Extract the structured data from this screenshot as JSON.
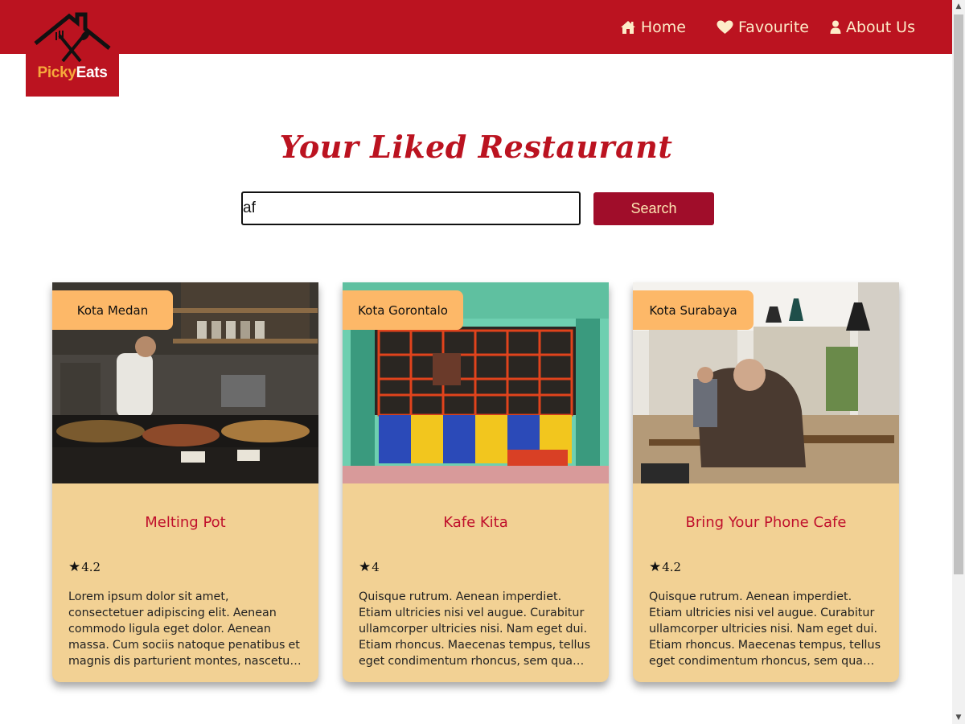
{
  "header": {
    "logo": {
      "part1": "Picky",
      "part2": "Eats"
    },
    "nav": [
      {
        "label": "Home",
        "icon": "home-icon"
      },
      {
        "label": "Favourite",
        "icon": "heart-icon"
      },
      {
        "label": "About Us",
        "icon": "user-icon"
      }
    ]
  },
  "main": {
    "title": "Your Liked Restaurant",
    "search": {
      "value": "af",
      "button_label": "Search"
    }
  },
  "restaurants": [
    {
      "city": "Kota Medan",
      "name": "Melting Pot",
      "rating": "4.2",
      "description": "Lorem ipsum dolor sit amet, consectetuer adipiscing elit. Aenean commodo ligula eget dolor. Aenean massa. Cum sociis natoque penatibus et magnis dis parturient montes, nascetur ridiculus mus."
    },
    {
      "city": "Kota Gorontalo",
      "name": "Kafe Kita",
      "rating": "4",
      "description": "Quisque rutrum. Aenean imperdiet. Etiam ultricies nisi vel augue. Curabitur ullamcorper ultricies nisi. Nam eget dui. Etiam rhoncus. Maecenas tempus, tellus eget condimentum rhoncus, sem quam semper libero."
    },
    {
      "city": "Kota Surabaya",
      "name": "Bring Your Phone Cafe",
      "rating": "4.2",
      "description": "Quisque rutrum. Aenean imperdiet. Etiam ultricies nisi vel augue. Curabitur ullamcorper ultricies nisi. Nam eget dui. Etiam rhoncus. Maecenas tempus, tellus eget condimentum rhoncus, sem quam semper libero."
    }
  ],
  "colors": {
    "brand_red": "#bb1320",
    "button_red": "#a00d2a",
    "card_bg": "#f2d194",
    "badge_orange": "#fdb868",
    "logo_orange": "#f6a93b"
  }
}
